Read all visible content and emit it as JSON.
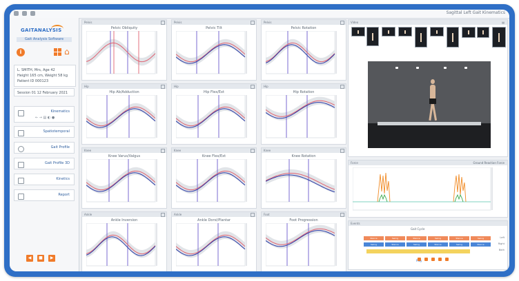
{
  "window": {
    "title": "",
    "top_right": "Sagittal Left  Gait Kinematics"
  },
  "sidebar": {
    "logo": "GAITANALYSIS",
    "subtitle": "Gait Analysis Software",
    "patient": [
      "L. SMITH, Mrs, Age 42",
      "Height 165 cm, Weight 58 kg",
      "Patient ID 000123"
    ],
    "session": "Session 01 12 February 2021",
    "items": [
      {
        "label": "Kinematics",
        "tools": "← → ▤ ◐ ●"
      },
      {
        "label": "Spatiotemporal"
      },
      {
        "label": "Gait Profile"
      },
      {
        "label": "Gait Profile 3D"
      },
      {
        "label": "Kinetics"
      },
      {
        "label": "Report"
      }
    ],
    "bottom_buttons": [
      "◀",
      "■",
      "▶"
    ]
  },
  "plots": [
    {
      "header": "Pelvis",
      "title": "Pelvic Obliquity"
    },
    {
      "header": "Pelvis",
      "title": "Pelvic Tilt"
    },
    {
      "header": "Pelvis",
      "title": "Pelvic Rotation"
    },
    {
      "header": "Hip",
      "title": "Hip Ab/Adduction"
    },
    {
      "header": "Hip",
      "title": "Hip Flex/Ext"
    },
    {
      "header": "Hip",
      "title": "Hip Rotation"
    },
    {
      "header": "Knee",
      "title": "Knee Varus/Valgus"
    },
    {
      "header": "Knee",
      "title": "Knee Flex/Ext"
    },
    {
      "header": "Knee",
      "title": "Knee Rotation"
    },
    {
      "header": "Ankle",
      "title": "Ankle Inversion"
    },
    {
      "header": "Ankle",
      "title": "Ankle Dorsi/Plantar"
    },
    {
      "header": "Foot",
      "title": "Foot Progression"
    }
  ],
  "right": {
    "video_header": "Video",
    "video_header_right": "▤",
    "force_header": "Force",
    "force_header_right": "Ground Reaction Force",
    "timeline_header": "Events",
    "timeline_label": "Gait Cycle",
    "timeline_right": [
      "Left",
      "Right",
      "Both"
    ],
    "timeline_rows": [
      [
        "Stance",
        "Swing",
        "Stance",
        "Swing",
        "Stance",
        "Swing"
      ],
      [
        "Swing",
        "Stance",
        "Swing",
        "Stance",
        "Swing",
        "Stance"
      ]
    ],
    "playback_label": "Play"
  },
  "colors": {
    "accent": "#f07b2a",
    "brand": "#2f6fc6",
    "left_series": "#e06070",
    "right_series": "#2b3aa8",
    "event_line": "#6a5acd"
  }
}
